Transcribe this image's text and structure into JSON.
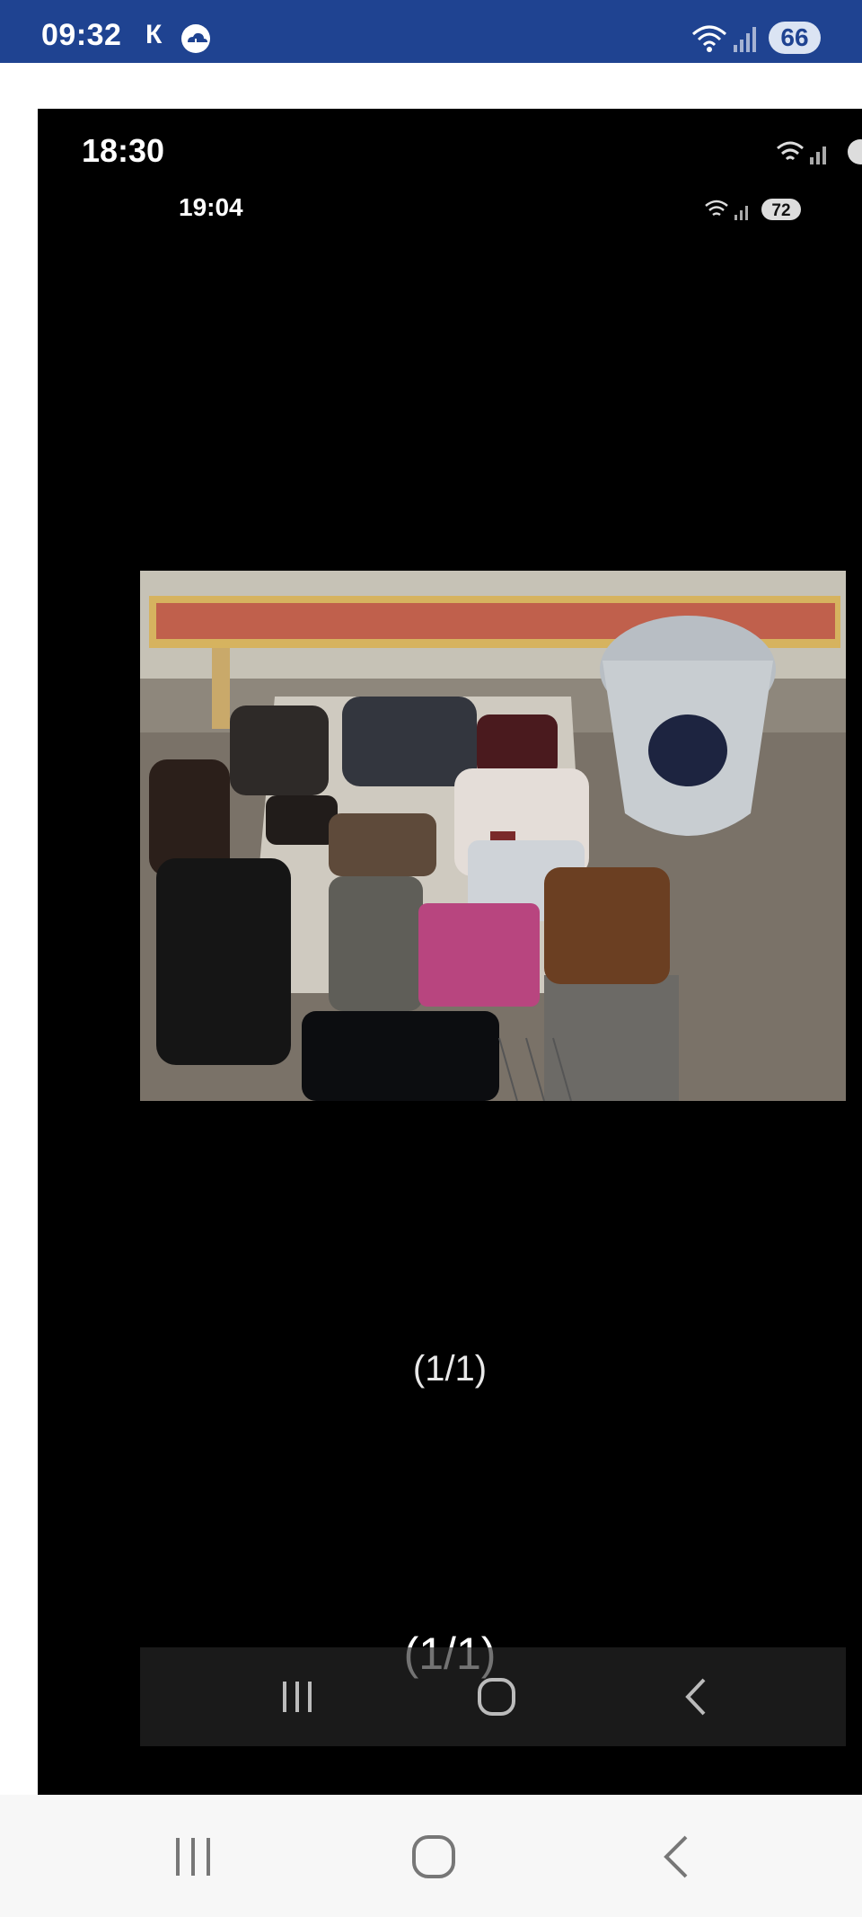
{
  "status_bar": {
    "time": "09:32",
    "carrier_letter": "К",
    "battery": "66",
    "icons": [
      "cloud-icon",
      "wifi-icon",
      "signal-icon"
    ]
  },
  "screenshot": {
    "status_time": "18:30",
    "inner_status_time": "19:04",
    "inner_battery": "72",
    "counter_top": "(1/1)",
    "counter_bottom": "(1/1)",
    "photo_description_icons": [
      "bags-photo"
    ],
    "nav_icons": [
      "recent-apps-icon",
      "home-icon",
      "back-icon"
    ]
  },
  "system_nav": {
    "icons": [
      "recent-apps-icon",
      "home-icon",
      "back-icon"
    ]
  },
  "colors": {
    "status_bar_bg": "#1f4391",
    "screenshot_bg": "#000000",
    "nav_bg": "#f7f7f7"
  }
}
